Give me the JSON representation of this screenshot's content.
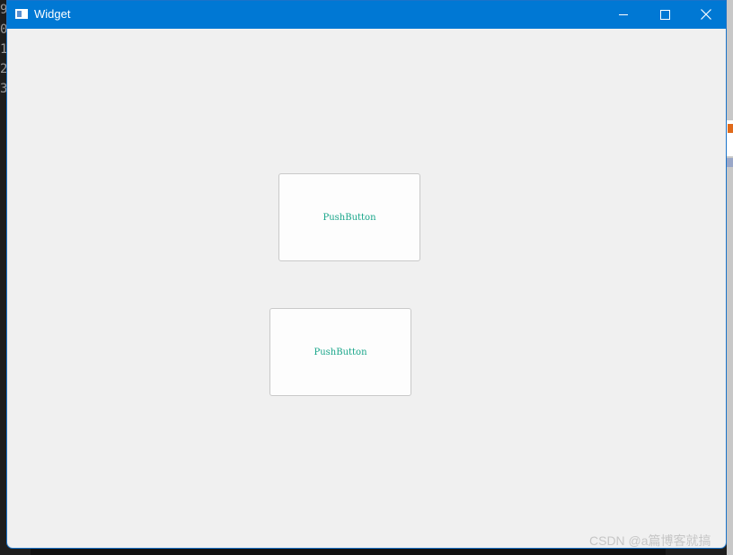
{
  "background": {
    "line_numbers": [
      "9",
      "0",
      "1",
      "2",
      "3"
    ]
  },
  "window": {
    "title": "Widget",
    "controls": {
      "minimize_icon": "minimize-icon",
      "maximize_icon": "maximize-icon",
      "close_icon": "close-icon"
    },
    "accent_color": "#0078d4"
  },
  "buttons": [
    {
      "label": "PushButton"
    },
    {
      "label": "PushButton"
    }
  ],
  "watermark": "CSDN @a篇博客就搞"
}
